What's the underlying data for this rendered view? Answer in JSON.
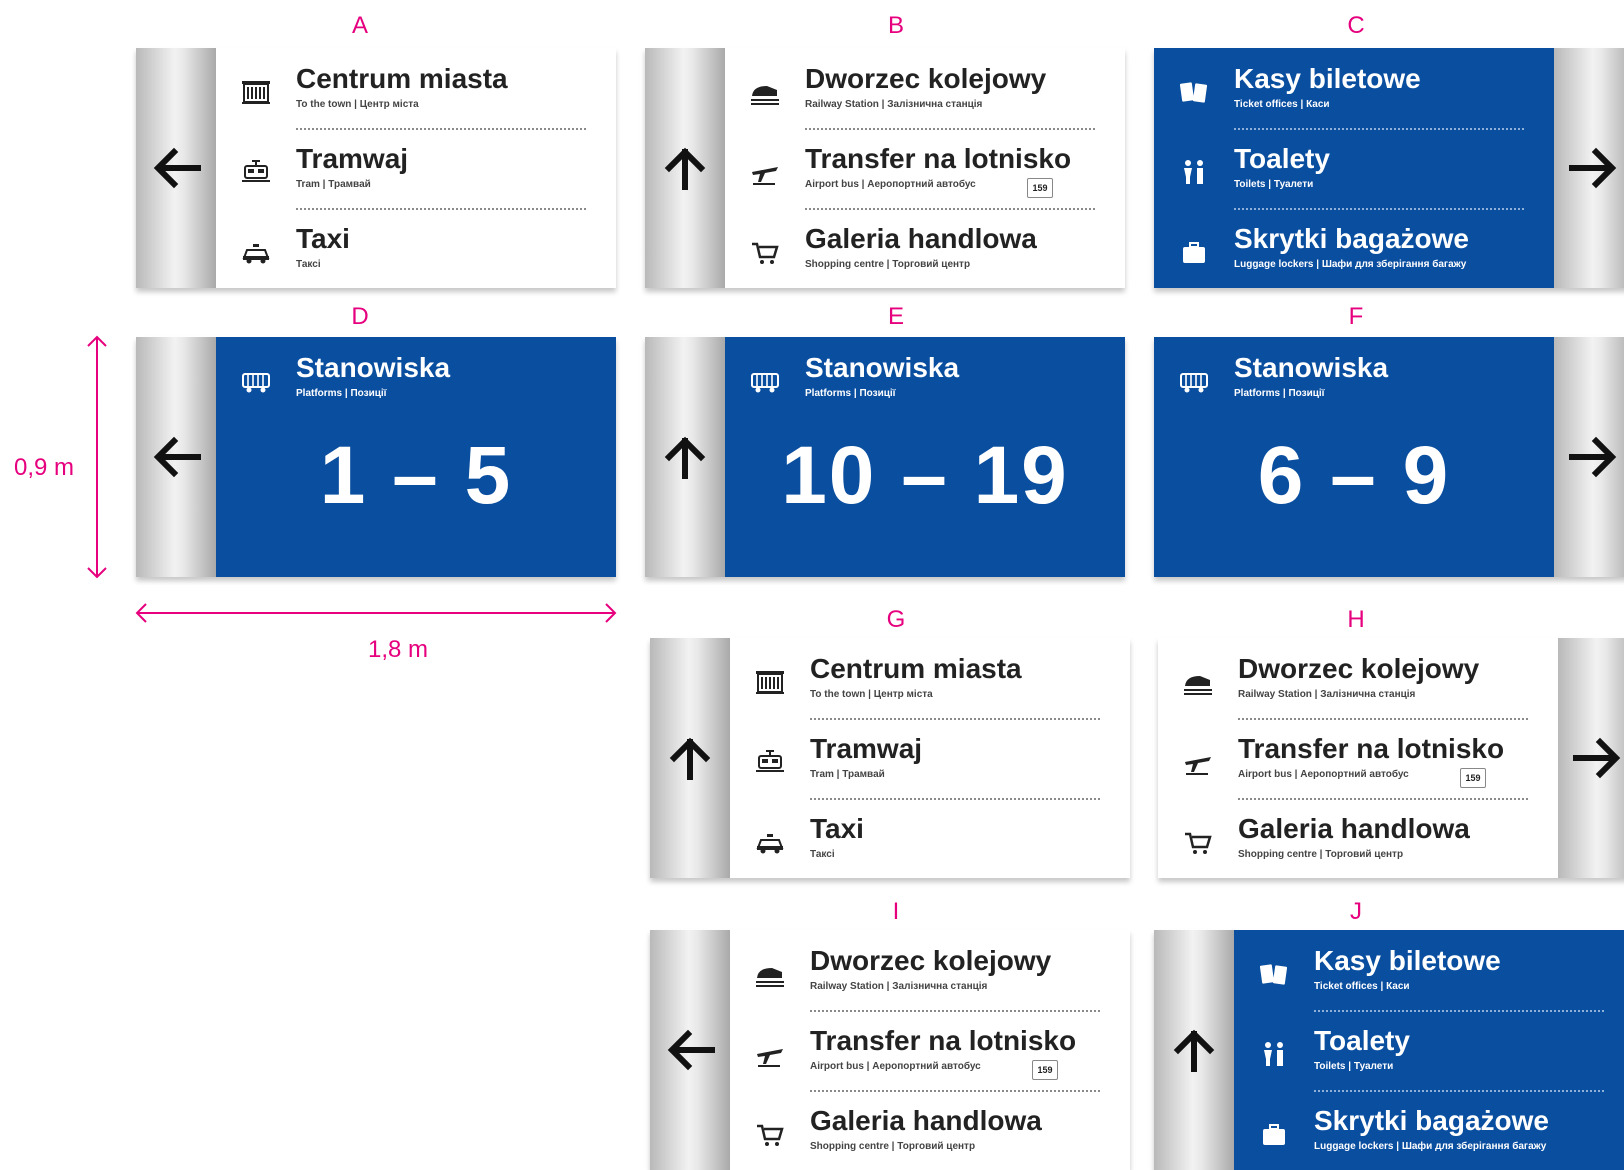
{
  "dimensions": {
    "height": "0,9 m",
    "width": "1,8 m"
  },
  "colors": {
    "blue": "#0a4ea0",
    "dimension": "#e6007e"
  },
  "signs": [
    {
      "letter": "A",
      "arrow": "left",
      "pole": "left",
      "theme": "white",
      "type": "list",
      "rows": [
        {
          "icon": "building-icon",
          "title": "Centrum miasta",
          "sub": "To the town | Центр міста"
        },
        {
          "icon": "tram-icon",
          "title": "Tramwaj",
          "sub": "Tram | Трамвай"
        },
        {
          "icon": "taxi-icon",
          "title": "Taxi",
          "sub": "Таксі"
        }
      ]
    },
    {
      "letter": "B",
      "arrow": "up",
      "pole": "left",
      "theme": "white",
      "type": "list",
      "rows": [
        {
          "icon": "train-icon",
          "title": "Dworzec kolejowy",
          "sub": "Railway Station | Залізнична станція"
        },
        {
          "icon": "plane-icon",
          "title": "Transfer na lotnisko",
          "sub": "Airport bus | Аеропортний автобус",
          "badge": "159"
        },
        {
          "icon": "cart-icon",
          "title": "Galeria handlowa",
          "sub": "Shopping centre | Торговий центр"
        }
      ]
    },
    {
      "letter": "C",
      "arrow": "right",
      "pole": "right",
      "theme": "blue",
      "type": "list",
      "rows": [
        {
          "icon": "tickets-icon",
          "title": "Kasy biletowe",
          "sub": "Ticket offices | Каси"
        },
        {
          "icon": "toilets-icon",
          "title": "Toalety",
          "sub": "Toilets | Туалети"
        },
        {
          "icon": "luggage-icon",
          "title": "Skrytki bagażowe",
          "sub": "Luggage lockers | Шафи для зберігання багажу"
        }
      ]
    },
    {
      "letter": "D",
      "arrow": "left",
      "pole": "left",
      "theme": "blue",
      "type": "platform",
      "rows": [
        {
          "icon": "bus-icon",
          "title": "Stanowiska",
          "sub": "Platforms | Позиції"
        }
      ],
      "range": "1 – 5"
    },
    {
      "letter": "E",
      "arrow": "up",
      "pole": "left",
      "theme": "blue",
      "type": "platform",
      "rows": [
        {
          "icon": "bus-icon",
          "title": "Stanowiska",
          "sub": "Platforms | Позиції"
        }
      ],
      "range": "10 – 19"
    },
    {
      "letter": "F",
      "arrow": "right",
      "pole": "right",
      "theme": "blue",
      "type": "platform",
      "rows": [
        {
          "icon": "bus-icon",
          "title": "Stanowiska",
          "sub": "Platforms | Позиції"
        }
      ],
      "range": "6 – 9"
    },
    {
      "letter": "G",
      "arrow": "up",
      "pole": "left",
      "theme": "white",
      "type": "list",
      "rows": [
        {
          "icon": "building-icon",
          "title": "Centrum miasta",
          "sub": "To the town | Центр міста"
        },
        {
          "icon": "tram-icon",
          "title": "Tramwaj",
          "sub": "Tram | Трамвай"
        },
        {
          "icon": "taxi-icon",
          "title": "Taxi",
          "sub": "Таксі"
        }
      ]
    },
    {
      "letter": "H",
      "arrow": "right",
      "pole": "right",
      "theme": "white",
      "type": "list",
      "rows": [
        {
          "icon": "train-icon",
          "title": "Dworzec kolejowy",
          "sub": "Railway Station | Залізнична станція"
        },
        {
          "icon": "plane-icon",
          "title": "Transfer na lotnisko",
          "sub": "Airport bus | Аеропортний автобус",
          "badge": "159"
        },
        {
          "icon": "cart-icon",
          "title": "Galeria handlowa",
          "sub": "Shopping centre | Торговий центр"
        }
      ]
    },
    {
      "letter": "I",
      "arrow": "left",
      "pole": "left",
      "theme": "white",
      "type": "list",
      "rows": [
        {
          "icon": "train-icon",
          "title": "Dworzec kolejowy",
          "sub": "Railway Station | Залізнична станція"
        },
        {
          "icon": "plane-icon",
          "title": "Transfer na lotnisko",
          "sub": "Airport bus | Аеропортний автобус",
          "badge": "159"
        },
        {
          "icon": "cart-icon",
          "title": "Galeria handlowa",
          "sub": "Shopping centre | Торговий центр"
        }
      ]
    },
    {
      "letter": "J",
      "arrow": "up",
      "pole": "left",
      "theme": "blue",
      "type": "list",
      "rows": [
        {
          "icon": "tickets-icon",
          "title": "Kasy biletowe",
          "sub": "Ticket offices | Каси"
        },
        {
          "icon": "toilets-icon",
          "title": "Toalety",
          "sub": "Toilets | Туалети"
        },
        {
          "icon": "luggage-icon",
          "title": "Skrytki bagażowe",
          "sub": "Luggage lockers | Шафи для зберігання багажу"
        }
      ]
    }
  ]
}
